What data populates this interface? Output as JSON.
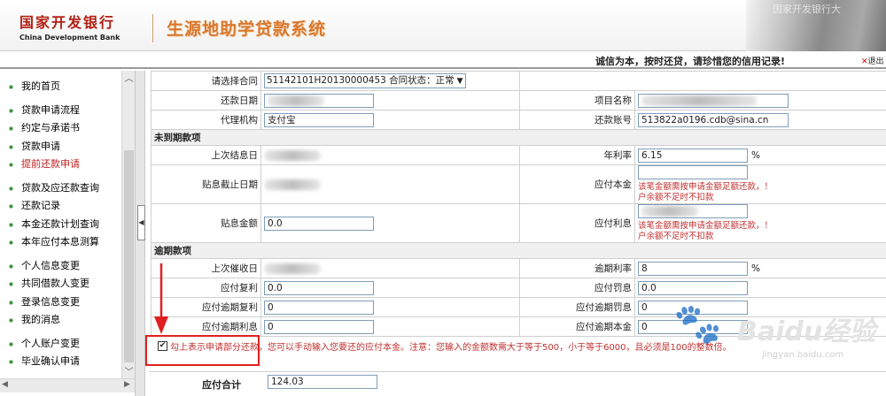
{
  "header": {
    "bank_cn": "国家开发银行",
    "bank_en": "China Development Bank",
    "system_title": "生源地助学贷款系统",
    "building_sign": "国家开发银行大"
  },
  "notice": "诚信为本，按时还贷，请珍惜您的信用记录!",
  "logout": "退出",
  "sidebar": {
    "groups": [
      {
        "items": [
          {
            "label": "我的首页"
          }
        ]
      },
      {
        "items": [
          {
            "label": "贷款申请流程"
          },
          {
            "label": "约定与承诺书"
          },
          {
            "label": "贷款申请"
          },
          {
            "label": "提前还款申请",
            "active": true
          }
        ]
      },
      {
        "items": [
          {
            "label": "贷款及应还款查询"
          },
          {
            "label": "还款记录"
          },
          {
            "label": "本金还款计划查询"
          },
          {
            "label": "本年应付本息测算"
          }
        ]
      },
      {
        "items": [
          {
            "label": "个人信息变更"
          },
          {
            "label": "共同借款人变更"
          },
          {
            "label": "登录信息变更"
          },
          {
            "label": "我的消息"
          }
        ]
      },
      {
        "items": [
          {
            "label": "个人账户变更"
          },
          {
            "label": "毕业确认申请"
          }
        ]
      }
    ]
  },
  "form": {
    "contract_label": "请选择合同",
    "contract_value": "51142101H20130000453  合同状态：正常",
    "repay_date_label": "还款日期",
    "project_name_label": "项目名称",
    "agent_label": "代理机构",
    "agent_value": "支付宝",
    "repay_account_label": "还款账号",
    "repay_account_value": "513822a0196.cdb@sina.cn",
    "section_not_due": "未到期款项",
    "last_settle_label": "上次结息日",
    "annual_rate_label": "年利率",
    "annual_rate_value": "6.15",
    "pct": "%",
    "interest_end_label": "贴息截止日期",
    "principal_due_label": "应付本金",
    "principal_warn": "该笔金额需按申请金额足额还款，！",
    "shortfall_hint": "户余额不足时不扣款",
    "interest_amount_label": "贴息金额",
    "interest_amount_value": "0.0",
    "interest_due_label": "应付利息",
    "interest_warn": "该笔金额需按申请金额足额还款，！",
    "section_overdue": "逾期款项",
    "last_collect_label": "上次催收日",
    "overdue_rate_label": "逾期利率",
    "overdue_rate_value": "8",
    "compound_due_label": "应付复利",
    "compound_due_value": "0.0",
    "penalty_due_label": "应付罚息",
    "penalty_due_value": "0.0",
    "overdue_compound_label": "应付逾期复利",
    "overdue_compound_value": "0",
    "overdue_penalty_label": "应付逾期罚息",
    "overdue_penalty_value": "0",
    "overdue_interest_label": "应付逾期利息",
    "overdue_interest_value": "0",
    "overdue_principal_label": "应付逾期本金",
    "overdue_principal_value": "0"
  },
  "checkbox_text": "勾上表示申请部分还款，您可以手动输入您要还的应付本金。注意：您输入的金额数需大于等于500，小于等于6000，且必须是100的整数倍。",
  "total_label": "应付合计",
  "total_value": "124.03",
  "watermark": {
    "logo": "Baidu",
    "suffix": "经验",
    "url": "jingyan.baidu.com"
  },
  "colors": {
    "bank_red": "#b22015",
    "title_orange": "#d9782d",
    "warn_red": "#c03030",
    "annotation_red": "#e02020"
  }
}
